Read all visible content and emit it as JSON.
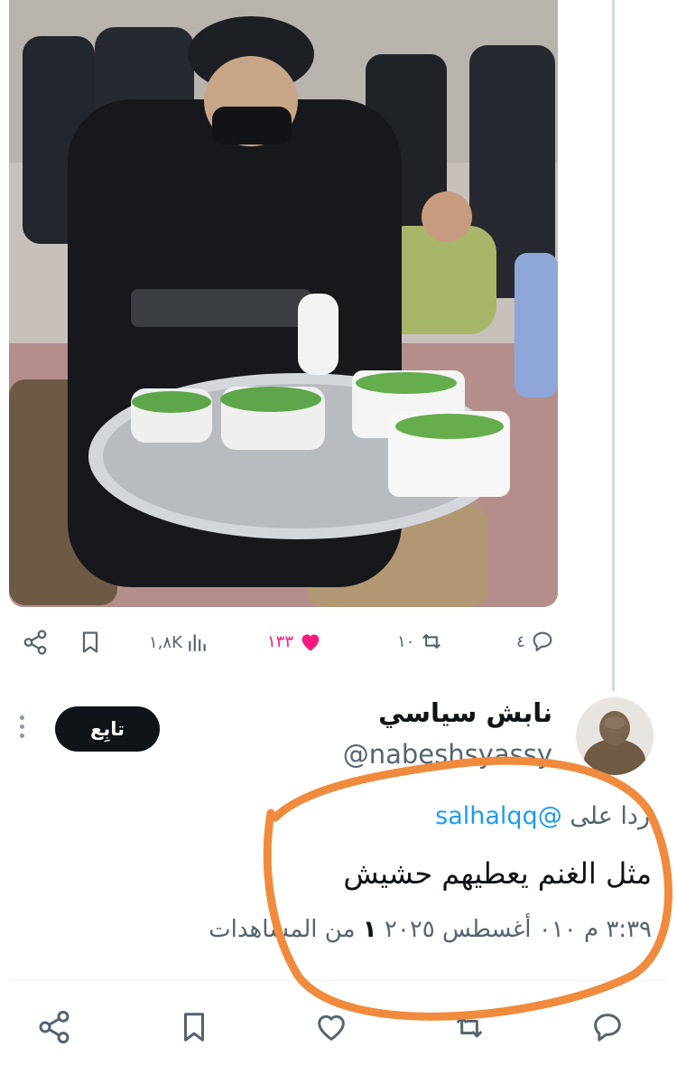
{
  "post_photo": {
    "alt": "photo"
  },
  "top_actions": {
    "replies": "٤",
    "retweets": "١٠",
    "likes": "١٣٣",
    "views": "١,٨K"
  },
  "reply_tweet": {
    "display_name": "نابش سياسي",
    "handle": "@nabeshsyassy",
    "follow_label": "تابِع",
    "replying_to_prefix": "ردا على",
    "replying_to_user": "@salhalqq",
    "text": "مثل الغنم يعطيهم حشيش",
    "time": "٣:٣٩ م",
    "date": "٠١٠ أغسطس ٢٠٢٥",
    "views_count": "١",
    "views_label": "من المشاهدات"
  },
  "colors": {
    "text": "#0f1419",
    "secondary": "#536471",
    "link": "#1d9bf0",
    "like": "#f91880",
    "annotation": "#f08a3c"
  },
  "icons": [
    "share-icon",
    "bookmark-icon",
    "views-icon",
    "heart-icon",
    "retweet-icon",
    "reply-icon"
  ]
}
